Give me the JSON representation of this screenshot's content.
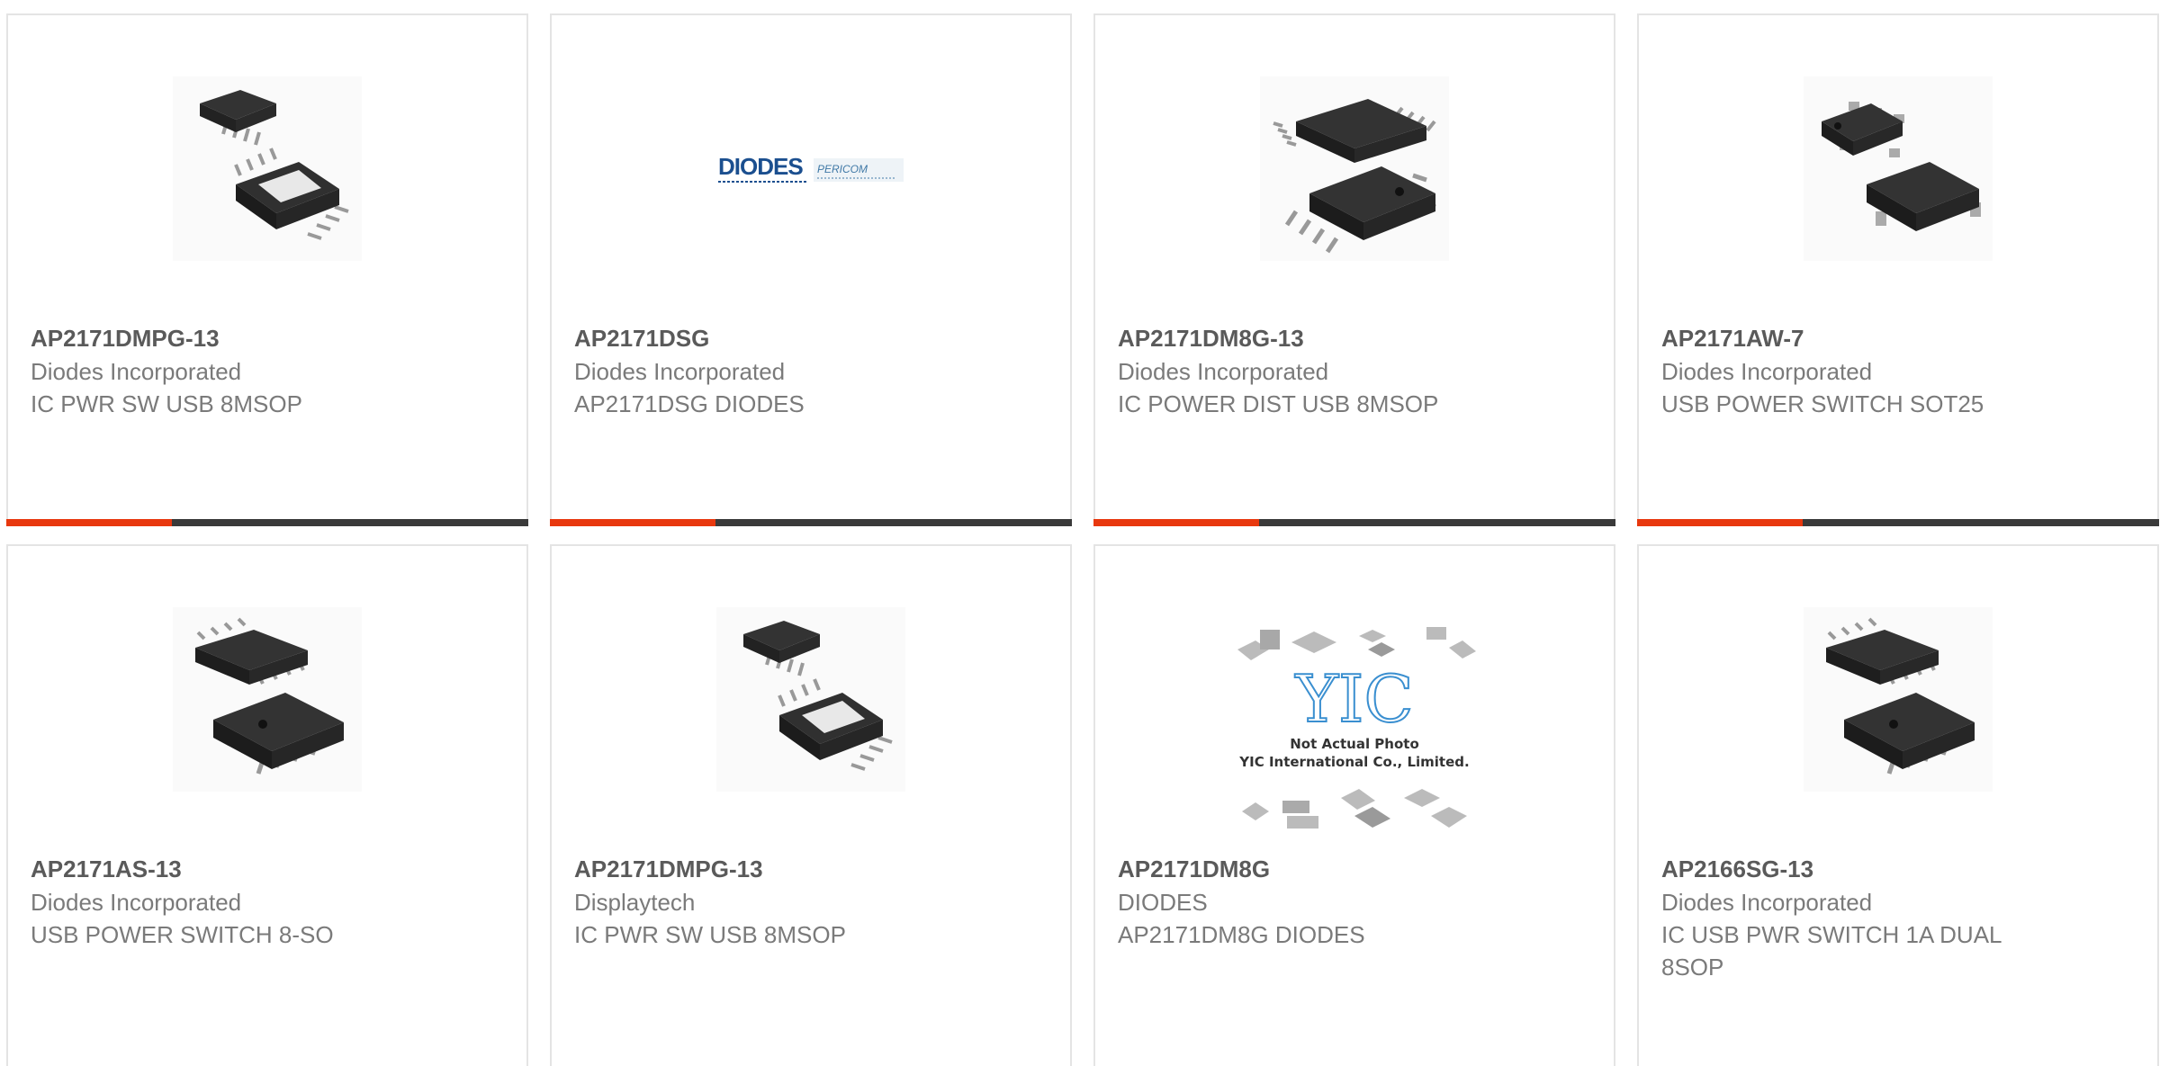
{
  "products": [
    {
      "part_number": "AP2171DMPG-13",
      "manufacturer": "Diodes Incorporated",
      "description": "IC PWR SW USB 8MSOP",
      "image": "msop8-package-photo"
    },
    {
      "part_number": "AP2171DSG",
      "manufacturer": "Diodes Incorporated",
      "description": "AP2171DSG DIODES",
      "image": "diodes-pericom-logo",
      "logo_text": "DIODES",
      "logo_sub": "PERICOM"
    },
    {
      "part_number": "AP2171DM8G-13",
      "manufacturer": "Diodes Incorporated",
      "description": "IC POWER DIST USB 8MSOP",
      "image": "msop8-package-photo"
    },
    {
      "part_number": "AP2171AW-7",
      "manufacturer": "Diodes Incorporated",
      "description": "USB POWER SWITCH SOT25",
      "image": "sot25-package-photo"
    },
    {
      "part_number": "AP2171AS-13",
      "manufacturer": "Diodes Incorporated",
      "description": "USB POWER SWITCH 8-SO",
      "image": "so8-package-photo"
    },
    {
      "part_number": "AP2171DMPG-13",
      "manufacturer": "Displaytech",
      "description": "IC PWR SW USB 8MSOP",
      "image": "msop8-package-photo"
    },
    {
      "part_number": "AP2171DM8G",
      "manufacturer": "DIODES",
      "description": "AP2171DM8G DIODES",
      "image": "yic-placeholder",
      "placeholder_logo": "YIC",
      "placeholder_line1": "Not Actual Photo",
      "placeholder_line2": "YIC International Co., Limited."
    },
    {
      "part_number": "AP2166SG-13",
      "manufacturer": "Diodes Incorporated",
      "description": "IC USB PWR SWITCH 1A DUAL 8SOP",
      "image": "so8-package-photo"
    }
  ],
  "colors": {
    "accent": "#e8380e",
    "bar": "#3a3a3a",
    "border": "#e4e4e4",
    "part_number": "#5a5a5a",
    "body_text": "#7a7a7a"
  }
}
